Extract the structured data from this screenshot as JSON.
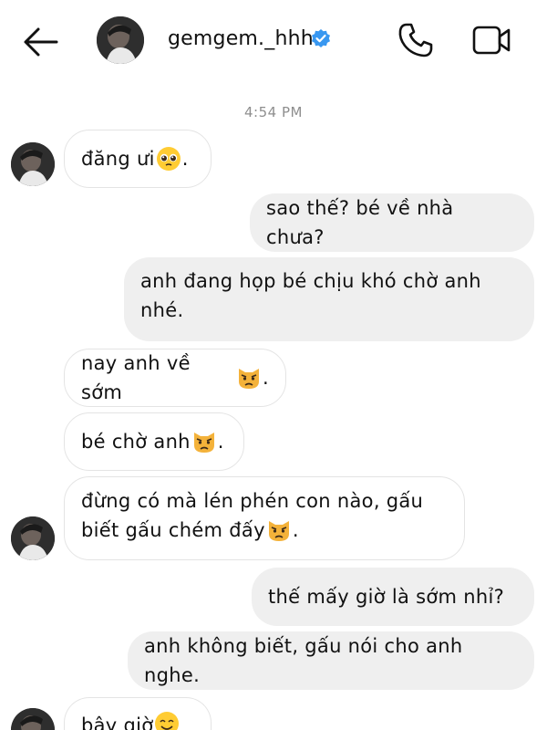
{
  "header": {
    "username": "gemgem._hhh"
  },
  "chat": {
    "timestamp": "4:54 PM",
    "messages": [
      {
        "side": "in",
        "text": "đăng ưi",
        "suffix": ".",
        "emoji": "pleading-face"
      },
      {
        "side": "out",
        "text": "sao thế? bé về nhà chưa?"
      },
      {
        "side": "out",
        "line1": "anh đang họp bé chịu khó chờ anh",
        "line2": "nhé."
      },
      {
        "side": "in",
        "text": "nay anh về sớm",
        "suffix": ".",
        "emoji": "pouting-cat"
      },
      {
        "side": "in",
        "text": "bé chờ anh",
        "suffix": ".",
        "emoji": "pouting-cat"
      },
      {
        "side": "in",
        "line1": "đừng có mà lén phén con nào, gấu",
        "line2": "biết gấu chém đấy",
        "suffix": ".",
        "emoji": "pouting-cat"
      },
      {
        "side": "out",
        "text": "thế mấy giờ là sớm nhỉ?"
      },
      {
        "side": "out",
        "text": "anh không biết, gấu nói cho anh nghe."
      },
      {
        "side": "in",
        "text": "bây giờ",
        "emoji": "smiling-face"
      }
    ]
  },
  "colors": {
    "verified": "#3897f0",
    "outgoing_bubble": "#efefef",
    "incoming_border": "#e4e4e4",
    "timestamp": "#8e8e8e"
  }
}
